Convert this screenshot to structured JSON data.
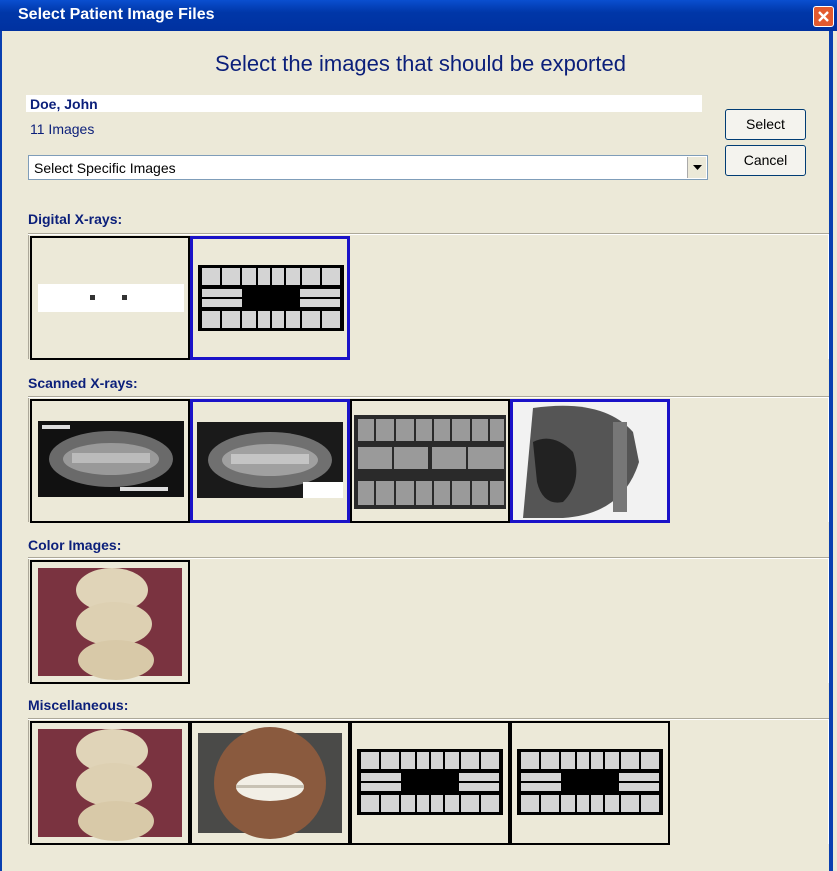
{
  "window": {
    "title": "Select Patient Image Files"
  },
  "header": {
    "instruction": "Select the images that should be exported"
  },
  "patient": {
    "name": "Doe, John",
    "image_count": "11 Images"
  },
  "filter": {
    "selected": "Select Specific Images"
  },
  "buttons": {
    "select": "Select",
    "cancel": "Cancel"
  },
  "sections": {
    "digital": {
      "label": "Digital X-rays:"
    },
    "scanned": {
      "label": "Scanned X-rays:"
    },
    "color": {
      "label": "Color Images:"
    },
    "misc": {
      "label": "Miscellaneous:"
    }
  },
  "colors": {
    "title_bar": "#0a4fd0",
    "text_accent": "#0b1f7a",
    "selection": "#1a12c8",
    "window_bg": "#ece9d8"
  }
}
